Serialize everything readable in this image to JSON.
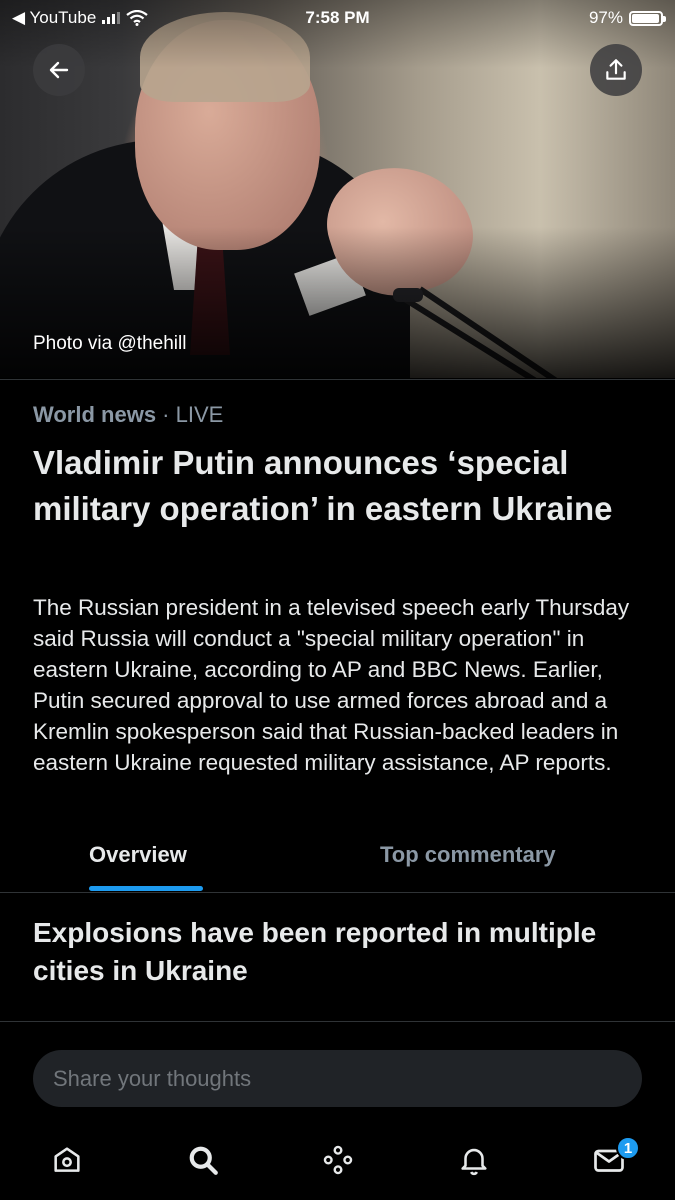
{
  "status_bar": {
    "back_app_label": "◀ YouTube",
    "time": "7:58 PM",
    "battery_percent": "97%",
    "battery_level": 0.97
  },
  "hero": {
    "photo_credit": "Photo via @thehill"
  },
  "article": {
    "category": "World news",
    "separator": " · ",
    "live_label": "LIVE",
    "headline": "Vladimir Putin announces ‘special military operation’ in eastern Ukraine",
    "summary": "The Russian president in a televised speech early Thursday said Russia will conduct a \"special military operation\" in eastern Ukraine, according to AP and BBC News. Earlier, Putin secured approval to use armed forces abroad and a Kremlin spokesperson said that Russian-backed leaders in eastern Ukraine requested military assistance, AP reports."
  },
  "tabs": [
    {
      "label": "Overview",
      "active": true
    },
    {
      "label": "Top commentary",
      "active": false
    }
  ],
  "overview": {
    "subhead": "Explosions have been reported in multiple cities in Ukraine"
  },
  "compose": {
    "placeholder": "Share your thoughts"
  },
  "bottom_nav": {
    "items": [
      "home-icon",
      "search-icon",
      "spaces-icon",
      "bell-icon",
      "mail-icon"
    ],
    "messages_badge": "1"
  },
  "colors": {
    "accent": "#1d9bf0",
    "background": "#000000",
    "muted_text": "#8b98a5"
  }
}
